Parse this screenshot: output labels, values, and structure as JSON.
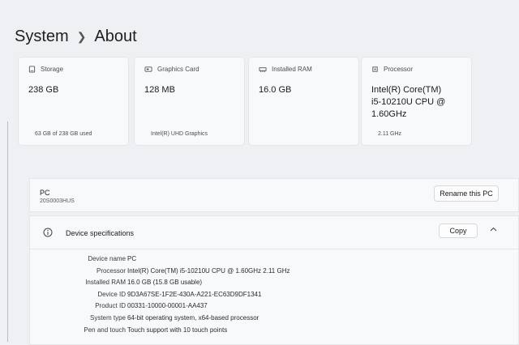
{
  "breadcrumb": {
    "parent": "System",
    "current": "About"
  },
  "cards": [
    {
      "label": "Storage",
      "icon": "storage-icon",
      "value": "238 GB",
      "sub": "63 GB of 238 GB used"
    },
    {
      "label": "Graphics Card",
      "icon": "graphics-card-icon",
      "value": "128 MB",
      "sub": "Intel(R) UHD Graphics"
    },
    {
      "label": "Installed RAM",
      "icon": "ram-icon",
      "value": "16.0 GB",
      "sub": ""
    },
    {
      "label": "Processor",
      "icon": "processor-icon",
      "value_lines": [
        "Intel(R) Core(TM)",
        "i5-10210U CPU @",
        "1.60GHz"
      ],
      "sub": "2.11 GHz"
    }
  ],
  "pc": {
    "name": "PC",
    "model": "20S0003HUS",
    "rename_label": "Rename this PC"
  },
  "device_specs": {
    "title": "Device specifications",
    "copy_label": "Copy",
    "rows": [
      {
        "key": "Device name",
        "value": "PC"
      },
      {
        "key": "Processor",
        "value": "Intel(R) Core(TM) i5-10210U CPU @ 1.60GHz   2.11 GHz"
      },
      {
        "key": "Installed RAM",
        "value": "16.0 GB (15.8 GB usable)"
      },
      {
        "key": "Device ID",
        "value": "9D3A67SE-1F2E-430A-A221-EC63D9DF1341"
      },
      {
        "key": "Product ID",
        "value": "00331-10000-00001-AA437"
      },
      {
        "key": "System type",
        "value": "64-bit operating system, x64-based processor"
      },
      {
        "key": "Pen and touch",
        "value": "Touch support with 10 touch points"
      }
    ]
  }
}
